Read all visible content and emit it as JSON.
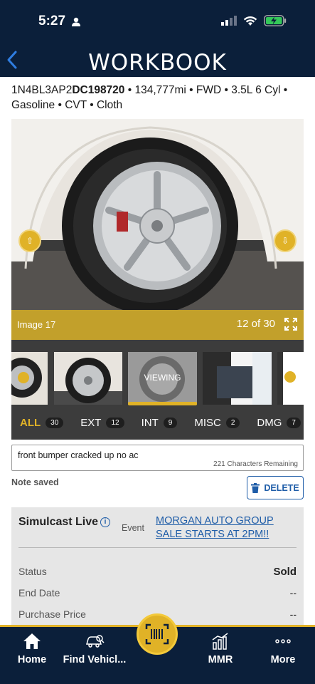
{
  "status_bar": {
    "time": "5:27"
  },
  "header": {
    "title": "WORKBOOK"
  },
  "vehicle": {
    "vin_prefix": "1N4BL3AP2",
    "vin_suffix": "DC198720",
    "details": " • 134,777mi • FWD • 3.5L 6 Cyl • Gasoline • CVT • Cloth"
  },
  "viewer": {
    "image_label": "Image 17",
    "count": "12 of 30",
    "viewing_label": "VIEWING"
  },
  "filters": [
    {
      "label": "ALL",
      "count": "30"
    },
    {
      "label": "EXT",
      "count": "12"
    },
    {
      "label": "INT",
      "count": "9"
    },
    {
      "label": "MISC",
      "count": "2"
    },
    {
      "label": "DMG",
      "count": "7"
    }
  ],
  "note": {
    "value": "front bumper cracked up no ac",
    "remaining": "221 Characters Remaining",
    "saved_label": "Note saved",
    "delete_label": "DELETE"
  },
  "simulcast": {
    "title": "Simulcast Live",
    "event_label": "Event",
    "event_link": "MORGAN AUTO GROUP SALE STARTS AT 2PM!!",
    "rows": [
      {
        "label": "Status",
        "value": "Sold"
      },
      {
        "label": "End Date",
        "value": "--"
      },
      {
        "label": "Purchase Price",
        "value": "--"
      }
    ]
  },
  "tabbar": {
    "home": "Home",
    "find": "Find Vehicl...",
    "mmr": "MMR",
    "more": "More"
  },
  "colors": {
    "navy": "#0b1f3a",
    "gold": "#e0b227",
    "link": "#1f5da8"
  }
}
